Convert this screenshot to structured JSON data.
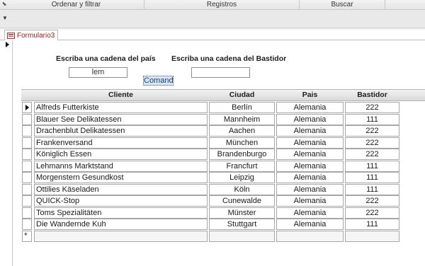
{
  "ribbon": {
    "groups": [
      {
        "label": "Ordenar y filtrar"
      },
      {
        "label": "Registros"
      },
      {
        "label": "Buscar"
      }
    ]
  },
  "tab": {
    "label": "Formulario3"
  },
  "form": {
    "pais_label": "Escriba una cadena del país",
    "pais_value": "lem",
    "bastidor_label": "Escriba una cadena del Bastidor",
    "bastidor_value": "",
    "command_label": "Comand"
  },
  "grid": {
    "columns": [
      "Cliente",
      "Ciudad",
      "Pais",
      "Bastidor"
    ],
    "rows": [
      {
        "cliente": "Alfreds Futterkiste",
        "ciudad": "Berlín",
        "pais": "Alemania",
        "bastidor": "222"
      },
      {
        "cliente": "Blauer See Delikatessen",
        "ciudad": "Mannheim",
        "pais": "Alemania",
        "bastidor": "111"
      },
      {
        "cliente": "Drachenblut Delikatessen",
        "ciudad": "Aachen",
        "pais": "Alemania",
        "bastidor": "222"
      },
      {
        "cliente": "Frankenversand",
        "ciudad": "München",
        "pais": "Alemania",
        "bastidor": "222"
      },
      {
        "cliente": "Königlich Essen",
        "ciudad": "Brandenburgo",
        "pais": "Alemania",
        "bastidor": "222"
      },
      {
        "cliente": "Lehmanns Marktstand",
        "ciudad": "Francfurt",
        "pais": "Alemania",
        "bastidor": "111"
      },
      {
        "cliente": "Morgenstern Gesundkost",
        "ciudad": "Leipzig",
        "pais": "Alemania",
        "bastidor": "111"
      },
      {
        "cliente": "Ottilies Käseladen",
        "ciudad": "Köln",
        "pais": "Alemania",
        "bastidor": "111"
      },
      {
        "cliente": "QUICK-Stop",
        "ciudad": "Cunewalde",
        "pais": "Alemania",
        "bastidor": "222"
      },
      {
        "cliente": "Toms Spezialitäten",
        "ciudad": "Münster",
        "pais": "Alemania",
        "bastidor": "222"
      },
      {
        "cliente": "Die Wandernde Kuh",
        "ciudad": "Stuttgart",
        "pais": "Alemania",
        "bastidor": "111"
      }
    ],
    "new_row_marker": "*"
  }
}
